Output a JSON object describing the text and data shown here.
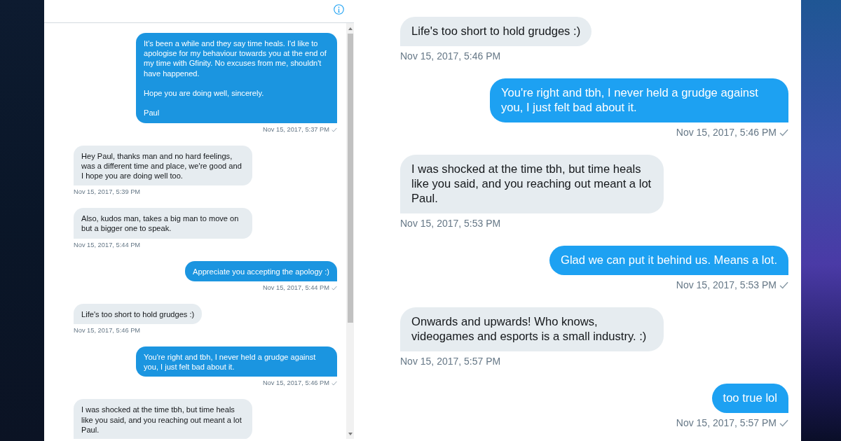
{
  "conversation_panel": {
    "messages": [
      {
        "kind": "sent",
        "text": "It's been a while and they say time heals. I'd like to apologise for my behaviour towards you at the end of my time with Gfinity. No excuses from me, shouldn't have happened.\n\nHope you are doing well, sincerely.\n\nPaul",
        "timestamp": "Nov 15, 2017, 5:37 PM"
      },
      {
        "kind": "received",
        "text": "Hey Paul, thanks man and no hard feelings, was a different time and place, we're good and I hope you are doing well too.",
        "timestamp": "Nov 15, 2017, 5:39 PM"
      },
      {
        "kind": "received",
        "text": "Also, kudos man, takes a big man to move on but a bigger one to speak.",
        "timestamp": "Nov 15, 2017, 5:44 PM"
      },
      {
        "kind": "sent",
        "text": "Appreciate you accepting the apology :)",
        "timestamp": "Nov 15, 2017, 5:44 PM"
      },
      {
        "kind": "received",
        "text": "Life's too short to hold grudges :)",
        "timestamp": "Nov 15, 2017, 5:46 PM"
      },
      {
        "kind": "sent",
        "text": "You're right and tbh, I never held a grudge against you, I just felt bad about it.",
        "timestamp": "Nov 15, 2017, 5:46 PM"
      },
      {
        "kind": "received",
        "text": "I was shocked at the time tbh, but time heals like you said, and you reaching out meant a lot Paul."
      }
    ]
  },
  "enlarged_view": {
    "messages": [
      {
        "kind": "received",
        "text": "Life's too short to hold grudges :)",
        "timestamp": "Nov 15, 2017, 5:46 PM"
      },
      {
        "kind": "sent",
        "text": "You're right and tbh, I never held a grudge against you, I just felt bad about it.",
        "timestamp": "Nov 15, 2017, 5:46 PM"
      },
      {
        "kind": "received",
        "text": "I was shocked at the time tbh, but time heals like you said, and you reaching out meant a lot Paul.",
        "timestamp": "Nov 15, 2017, 5:53 PM"
      },
      {
        "kind": "sent",
        "text": "Glad we can put it behind us. Means a lot.",
        "timestamp": "Nov 15, 2017, 5:53 PM"
      },
      {
        "kind": "received",
        "text": "Onwards and upwards! Who knows, videogames and esports is a small industry. :)",
        "timestamp": "Nov 15, 2017, 5:57 PM"
      },
      {
        "kind": "sent",
        "text": "too true lol",
        "timestamp": "Nov 15, 2017, 5:57 PM"
      }
    ]
  }
}
